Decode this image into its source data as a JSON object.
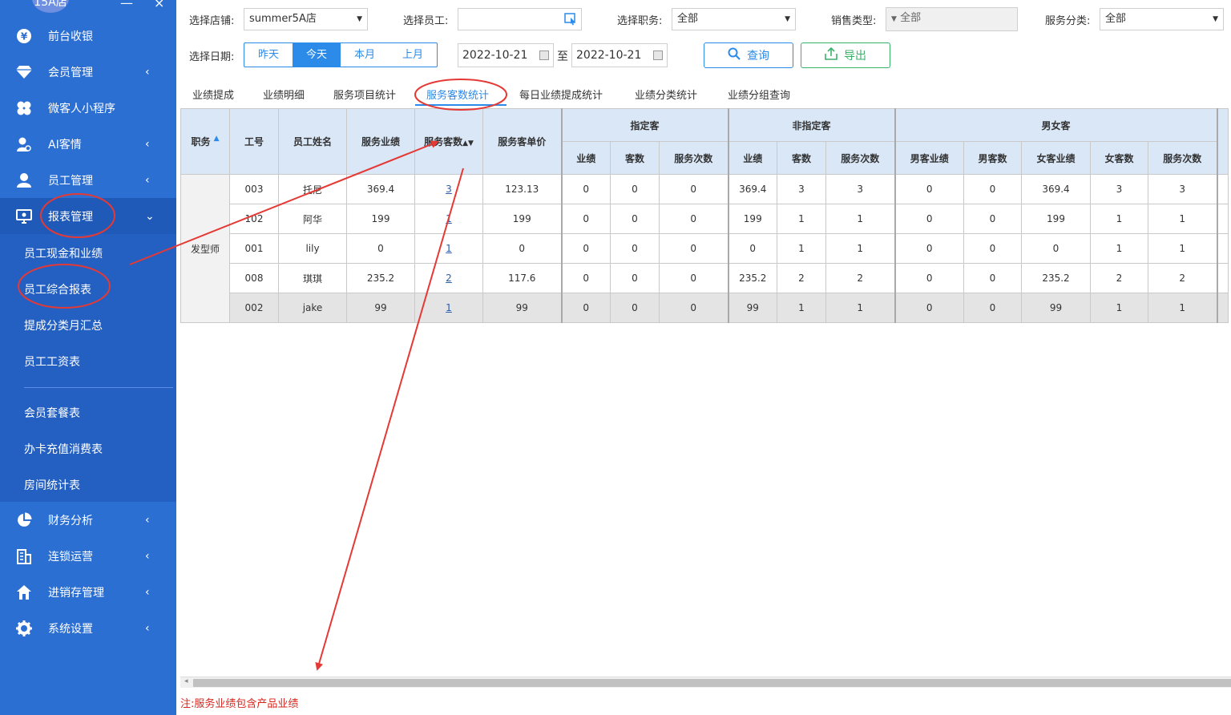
{
  "sidebar": {
    "store_badge": "15A店",
    "minus": "—",
    "close": "×",
    "items": [
      {
        "label": "前台收银",
        "icon": "yen-icon",
        "chevron": ""
      },
      {
        "label": "会员管理",
        "icon": "diamond-icon",
        "chevron": "‹"
      },
      {
        "label": "微客人小程序",
        "icon": "clover-icon",
        "chevron": ""
      },
      {
        "label": "AI客情",
        "icon": "user-search-icon",
        "chevron": "‹"
      },
      {
        "label": "员工管理",
        "icon": "user-icon",
        "chevron": "‹"
      },
      {
        "label": "报表管理",
        "icon": "monitor-icon",
        "chevron": "⌄"
      },
      {
        "label": "财务分析",
        "icon": "pie-chart-icon",
        "chevron": "‹"
      },
      {
        "label": "连锁运营",
        "icon": "building-icon",
        "chevron": "‹"
      },
      {
        "label": "进销存管理",
        "icon": "home-icon",
        "chevron": "‹"
      },
      {
        "label": "系统设置",
        "icon": "gear-icon",
        "chevron": "‹"
      }
    ],
    "subitems": [
      "员工现金和业绩",
      "员工综合报表",
      "提成分类月汇总",
      "员工工资表",
      "会员套餐表",
      "办卡充值消费表",
      "房间统计表"
    ]
  },
  "filters": {
    "store_label": "选择店铺:",
    "store_value": "summer5A店",
    "employee_label": "选择员工:",
    "employee_value": "",
    "position_label": "选择职务:",
    "position_value": "全部",
    "sales_type_label": "销售类型:",
    "sales_type_value": "全部",
    "service_cat_label": "服务分类:",
    "service_cat_value": "全部",
    "date_label": "选择日期:",
    "date_buttons": [
      "昨天",
      "今天",
      "本月",
      "上月"
    ],
    "date_from": "2022-10-21",
    "date_to_sep": "至",
    "date_to": "2022-10-21",
    "query_label": "查询",
    "export_label": "导出"
  },
  "tabs": [
    "业绩提成",
    "业绩明细",
    "服务项目统计",
    "服务客数统计",
    "每日业绩提成统计",
    "业绩分类统计",
    "业绩分组查询"
  ],
  "table": {
    "headers": {
      "position": "职务",
      "emp_no": "工号",
      "emp_name": "员工姓名",
      "service_perf": "服务业绩",
      "service_count": "服务客数",
      "unit_price": "服务客单价",
      "group_designated": "指定客",
      "group_non_designated": "非指定客",
      "group_gender": "男女客",
      "perf": "业绩",
      "guests": "客数",
      "times": "服务次数",
      "male_perf": "男客业绩",
      "male_count": "男客数",
      "female_perf": "女客业绩",
      "female_count": "女客数"
    },
    "position_value": "发型师",
    "rows": [
      {
        "no": "003",
        "name": "托尼",
        "perf": "369.4",
        "count": "3",
        "unit": "123.13",
        "d_perf": "0",
        "d_guests": "0",
        "d_times": "0",
        "n_perf": "369.4",
        "n_guests": "3",
        "n_times": "3",
        "m_perf": "0",
        "m_count": "0",
        "f_perf": "369.4",
        "f_count": "3",
        "times": "3"
      },
      {
        "no": "102",
        "name": "阿华",
        "perf": "199",
        "count": "1",
        "unit": "199",
        "d_perf": "0",
        "d_guests": "0",
        "d_times": "0",
        "n_perf": "199",
        "n_guests": "1",
        "n_times": "1",
        "m_perf": "0",
        "m_count": "0",
        "f_perf": "199",
        "f_count": "1",
        "times": "1"
      },
      {
        "no": "001",
        "name": "lily",
        "perf": "0",
        "count": "1",
        "unit": "0",
        "d_perf": "0",
        "d_guests": "0",
        "d_times": "0",
        "n_perf": "0",
        "n_guests": "1",
        "n_times": "1",
        "m_perf": "0",
        "m_count": "0",
        "f_perf": "0",
        "f_count": "1",
        "times": "1"
      },
      {
        "no": "008",
        "name": "琪琪",
        "perf": "235.2",
        "count": "2",
        "unit": "117.6",
        "d_perf": "0",
        "d_guests": "0",
        "d_times": "0",
        "n_perf": "235.2",
        "n_guests": "2",
        "n_times": "2",
        "m_perf": "0",
        "m_count": "0",
        "f_perf": "235.2",
        "f_count": "2",
        "times": "2"
      },
      {
        "no": "002",
        "name": "jake",
        "perf": "99",
        "count": "1",
        "unit": "99",
        "d_perf": "0",
        "d_guests": "0",
        "d_times": "0",
        "n_perf": "99",
        "n_guests": "1",
        "n_times": "1",
        "m_perf": "0",
        "m_count": "0",
        "f_perf": "99",
        "f_count": "1",
        "times": "1"
      }
    ]
  },
  "note": "注:服务业绩包含产品业绩",
  "colors": {
    "sidebar": "#2c6fd2",
    "accent": "#2c8ae8",
    "export": "#3bb26a",
    "annotation": "#e53935",
    "note": "#d9251c"
  }
}
